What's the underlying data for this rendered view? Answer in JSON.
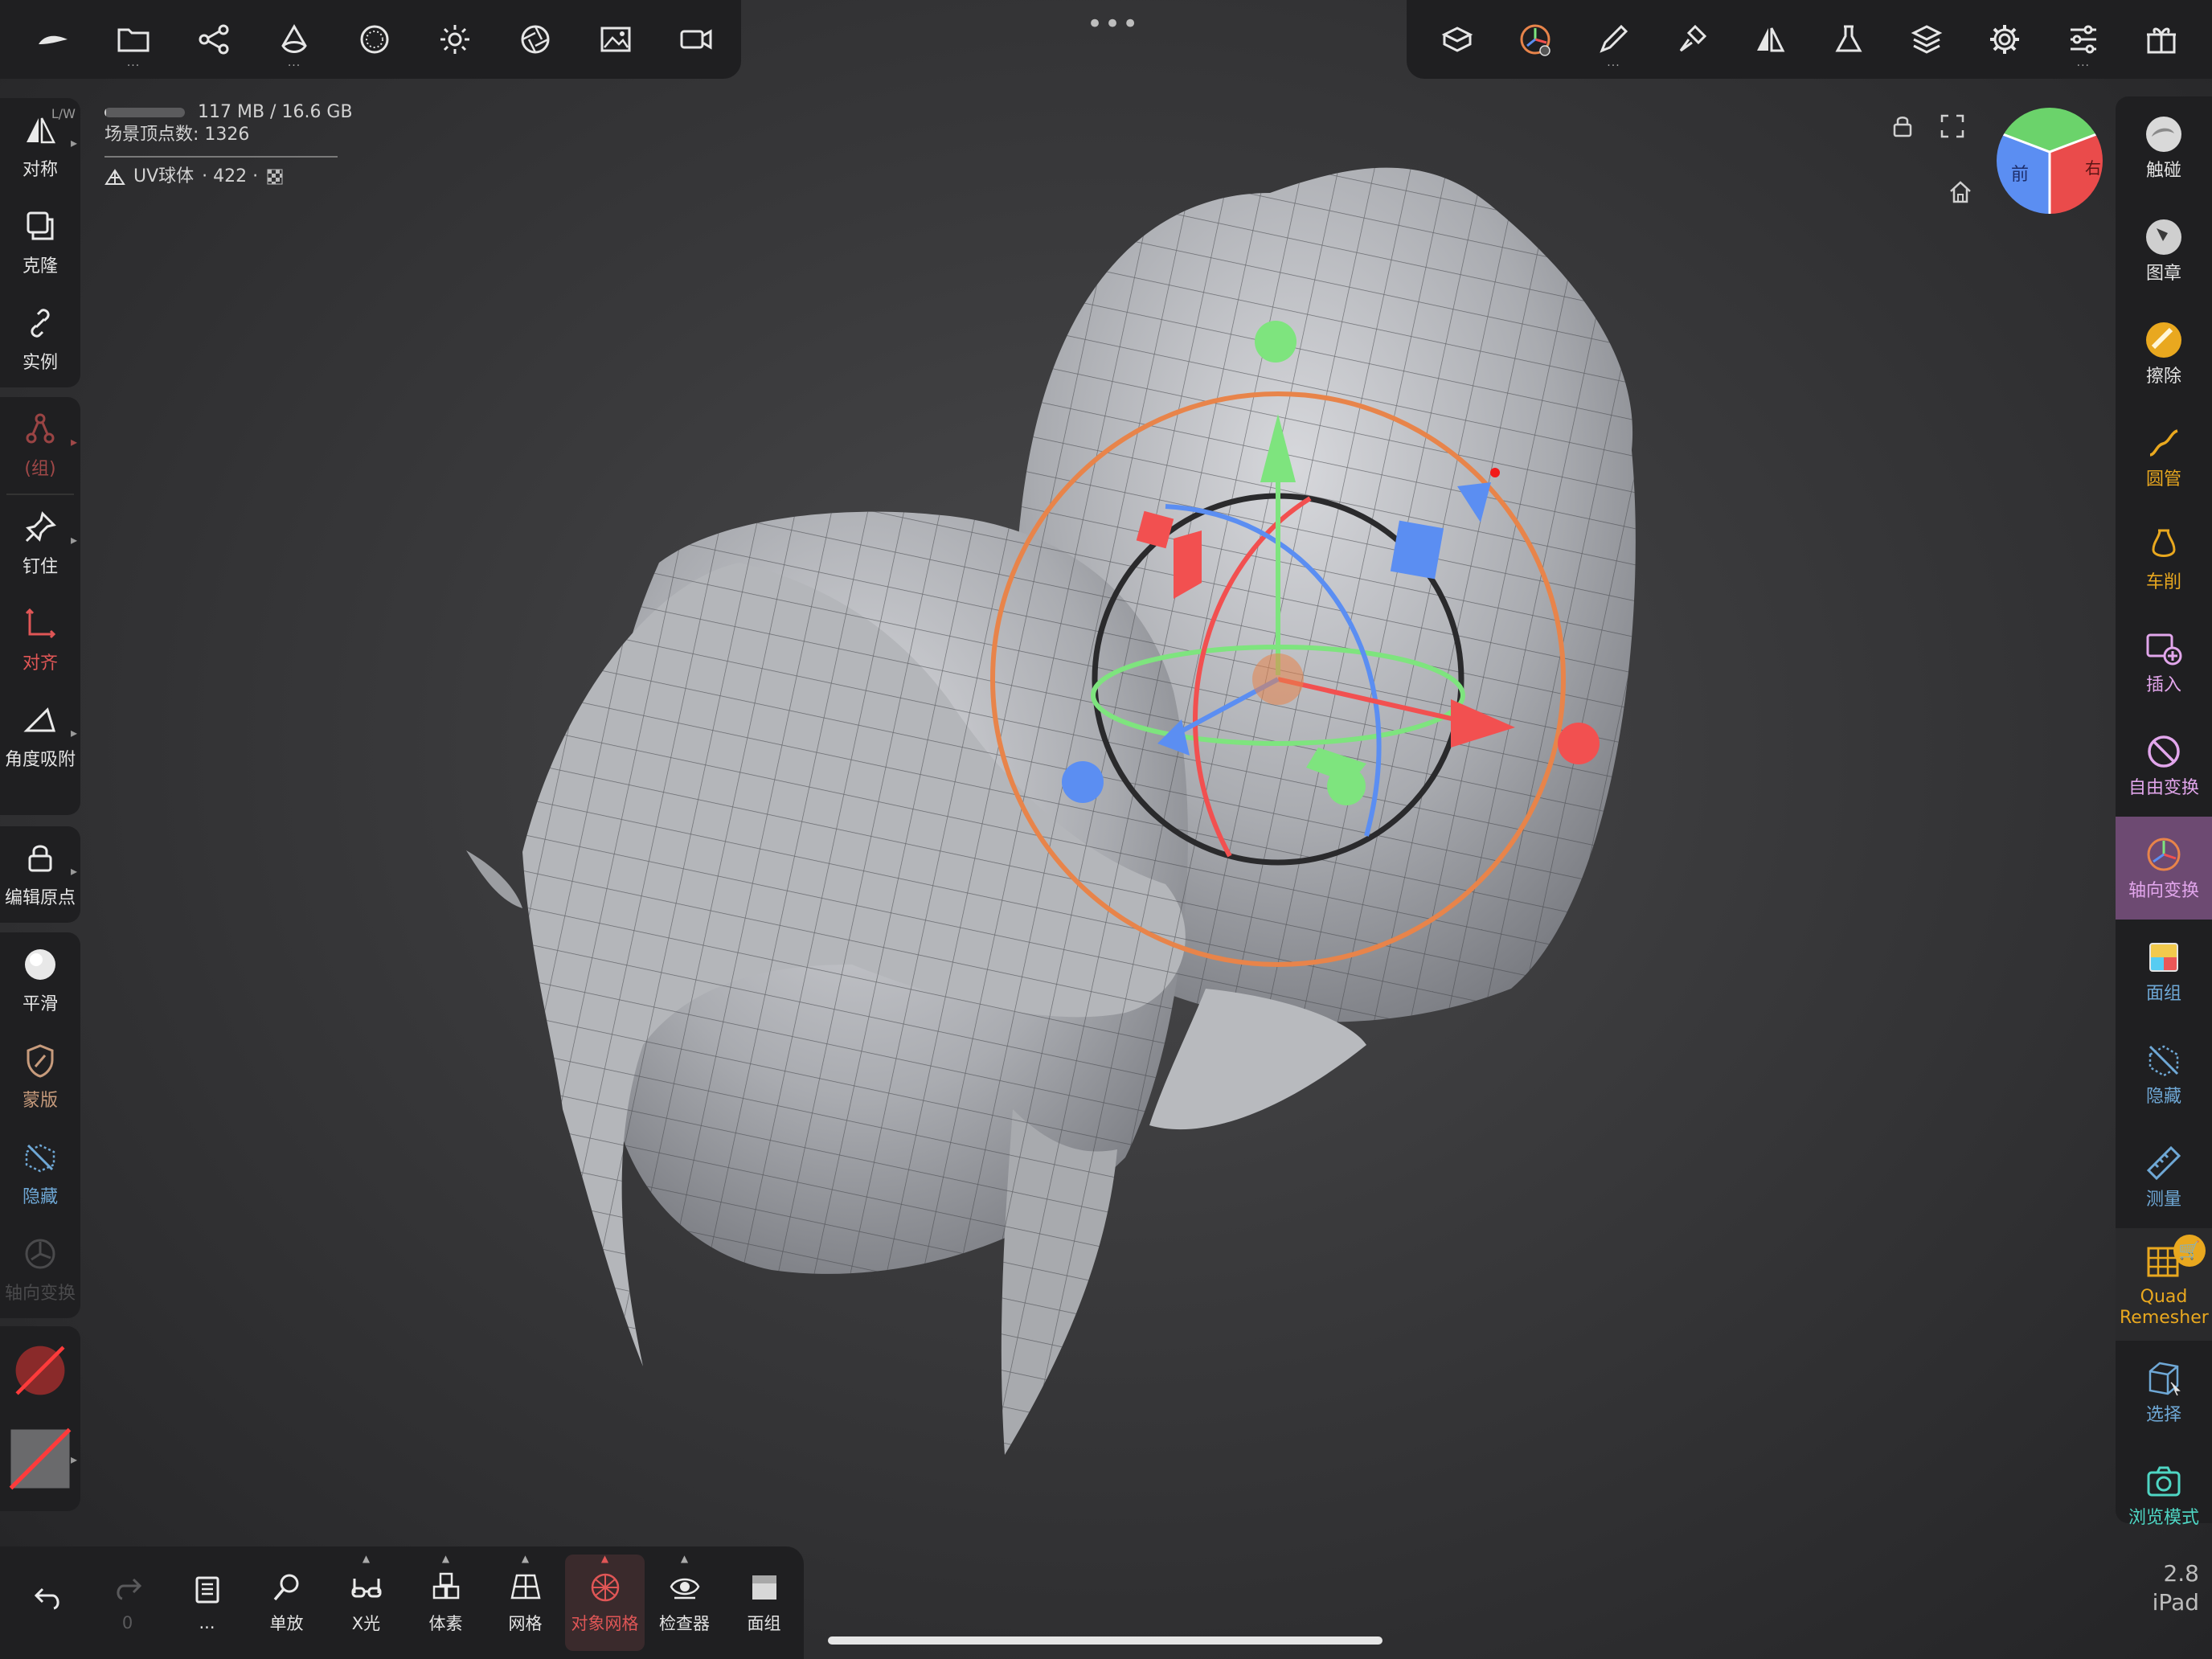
{
  "stats": {
    "memory": "117 MB / 16.6 GB",
    "memory_fraction": 0.007,
    "vertex_label": "场景顶点数: 1326",
    "object_name": "UV球体",
    "object_count": "· 422 ·"
  },
  "top_toolbar_left": [
    {
      "name": "logo-icon"
    },
    {
      "name": "folder-icon",
      "dots": "..."
    },
    {
      "name": "share-nodes-icon"
    },
    {
      "name": "material-sphere-icon",
      "dots": "..."
    },
    {
      "name": "matcap-icon"
    },
    {
      "name": "sun-icon"
    },
    {
      "name": "aperture-icon"
    },
    {
      "name": "image-icon"
    },
    {
      "name": "video-camera-icon"
    }
  ],
  "more_dots": "•••",
  "top_toolbar_right": [
    {
      "name": "scene-cube-icon"
    },
    {
      "name": "gizmo-settings-icon"
    },
    {
      "name": "brush-icon",
      "dots": "..."
    },
    {
      "name": "paint-brush-icon"
    },
    {
      "name": "symmetry-icon"
    },
    {
      "name": "flask-icon"
    },
    {
      "name": "layers-icon"
    },
    {
      "name": "gear-icon"
    },
    {
      "name": "sliders-icon",
      "dots": "..."
    },
    {
      "name": "gift-icon"
    }
  ],
  "left_panel": {
    "lw_tag": "L/W",
    "symmetry": "对称",
    "clone": "克隆",
    "instance": "实例",
    "group": "(组)",
    "pin": "钉住",
    "align": "对齐",
    "angle_snap": "角度吸附",
    "edit_origin": "编辑原点",
    "smooth": "平滑",
    "mask": "蒙版",
    "hide": "隐藏",
    "axial_transform": "轴向变换"
  },
  "right_panel": {
    "contact": "触碰",
    "stamp": "图章",
    "erase": "擦除",
    "tube": "圆管",
    "lathe": "车削",
    "insert": "插入",
    "free_transform": "自由变换",
    "axial_transform": "轴向变换",
    "face_group": "面组",
    "hide": "隐藏",
    "measure": "测量",
    "quad_remesher": "Quad Remesher",
    "select": "选择",
    "browse_mode": "浏览模式"
  },
  "bottom_bar": {
    "undo_count": "",
    "redo_count": "0",
    "book_dots": "...",
    "solo": "单放",
    "xray": "X光",
    "voxel": "体素",
    "mesh": "网格",
    "object_mesh": "对象网格",
    "inspector": "检查器",
    "face_group": "面组"
  },
  "navcube": {
    "front_label": "前",
    "right_label": "右"
  },
  "device": {
    "version": "2.8",
    "name": "iPad"
  },
  "colors": {
    "accent_red": "#e05656",
    "accent_purple": "#6d4a72",
    "gizmo_x": "#f25050",
    "gizmo_y": "#7ee47e",
    "gizmo_z": "#5b8ef2",
    "gizmo_ring": "#e8844a",
    "active_label": "#e2a6ec",
    "quad_label": "#e9a81f"
  }
}
